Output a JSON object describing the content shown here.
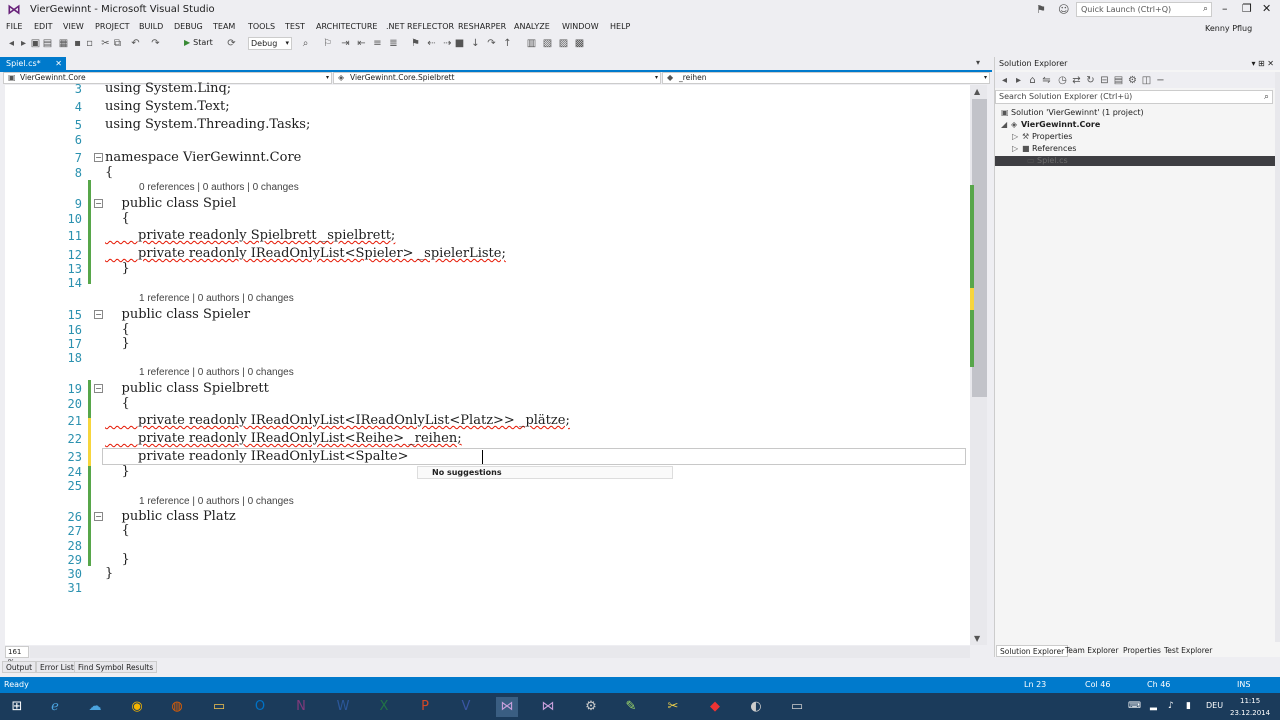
{
  "window": {
    "title": "VierGewinnt - Microsoft Visual Studio",
    "quick_launch_placeholder": "Quick Launch (Ctrl+Q)",
    "user": "Kenny Pflug"
  },
  "menu": [
    "FILE",
    "EDIT",
    "VIEW",
    "PROJECT",
    "BUILD",
    "DEBUG",
    "TEAM",
    "TOOLS",
    "TEST",
    "ARCHITECTURE",
    ".NET REFLECTOR",
    "RESHARPER",
    "ANALYZE",
    "WINDOW",
    "HELP"
  ],
  "toolbar": {
    "start_label": "Start",
    "configuration": "Debug"
  },
  "doc_tab": {
    "label": "Spiel.cs*"
  },
  "navbar": {
    "project": "VierGewinnt.Core",
    "type": "VierGewinnt.Core.Spielbrett",
    "member": "_reihen"
  },
  "editor": {
    "lines": [
      {
        "n": "3",
        "text": "using System.Linq;"
      },
      {
        "n": "4",
        "text": "using System.Text;"
      },
      {
        "n": "5",
        "text": "using System.Threading.Tasks;"
      },
      {
        "n": "6",
        "text": ""
      },
      {
        "n": "7",
        "text": "namespace VierGewinnt.Core"
      },
      {
        "n": "8",
        "text": "{"
      },
      {
        "n": "9",
        "text": "    public class Spiel"
      },
      {
        "n": "10",
        "text": "    {"
      },
      {
        "n": "11",
        "text": "        private readonly Spielbrett _spielbrett;"
      },
      {
        "n": "12",
        "text": "        private readonly IReadOnlyList<Spieler> _spielerListe;"
      },
      {
        "n": "13",
        "text": "    }"
      },
      {
        "n": "14",
        "text": ""
      },
      {
        "n": "15",
        "text": "    public class Spieler"
      },
      {
        "n": "16",
        "text": "    {"
      },
      {
        "n": "17",
        "text": "    }"
      },
      {
        "n": "18",
        "text": ""
      },
      {
        "n": "19",
        "text": "    public class Spielbrett"
      },
      {
        "n": "20",
        "text": "    {"
      },
      {
        "n": "21",
        "text": "        private readonly IReadOnlyList<IReadOnlyList<Platz>> _plätze;"
      },
      {
        "n": "22",
        "text": "        private readonly IReadOnlyList<Reihe> _reihen;"
      },
      {
        "n": "23",
        "text": "        private readonly IReadOnlyList<Spalte>"
      },
      {
        "n": "24",
        "text": "    }"
      },
      {
        "n": "25",
        "text": ""
      },
      {
        "n": "26",
        "text": "    public class Platz"
      },
      {
        "n": "27",
        "text": "    {"
      },
      {
        "n": "28",
        "text": ""
      },
      {
        "n": "29",
        "text": "    }"
      },
      {
        "n": "30",
        "text": "}"
      },
      {
        "n": "31",
        "text": ""
      }
    ],
    "lens": [
      "0 references | 0 authors | 0 changes",
      "1 reference | 0 authors | 0 changes",
      "1 reference | 0 authors | 0 changes",
      "1 reference | 0 authors | 0 changes"
    ],
    "suggestion": "No suggestions",
    "zoom": "161 %"
  },
  "solution_explorer": {
    "title": "Solution Explorer",
    "search_placeholder": "Search Solution Explorer (Ctrl+ü)",
    "items": [
      {
        "label": "Solution 'VierGewinnt' (1 project)"
      },
      {
        "label": "VierGewinnt.Core"
      },
      {
        "label": "Properties"
      },
      {
        "label": "References"
      },
      {
        "label": "Spiel.cs"
      }
    ],
    "tabs": [
      "Solution Explorer",
      "Team Explorer",
      "Properties",
      "Test Explorer"
    ]
  },
  "bottom_tabs": [
    "Output",
    "Error List",
    "Find Symbol Results"
  ],
  "status": {
    "state": "Ready",
    "ln": "Ln 23",
    "col": "Col 46",
    "ch": "Ch 46",
    "mode": "INS"
  },
  "tray": {
    "lang": "DEU",
    "time": "11:15",
    "date": "23.12.2014"
  },
  "colors": {
    "accent": "#007acc",
    "keyword": "#1e1e1e",
    "line_number": "#2b91af",
    "squiggle": "#e51400",
    "changed": "#f7d53c",
    "saved": "#57a64a"
  }
}
